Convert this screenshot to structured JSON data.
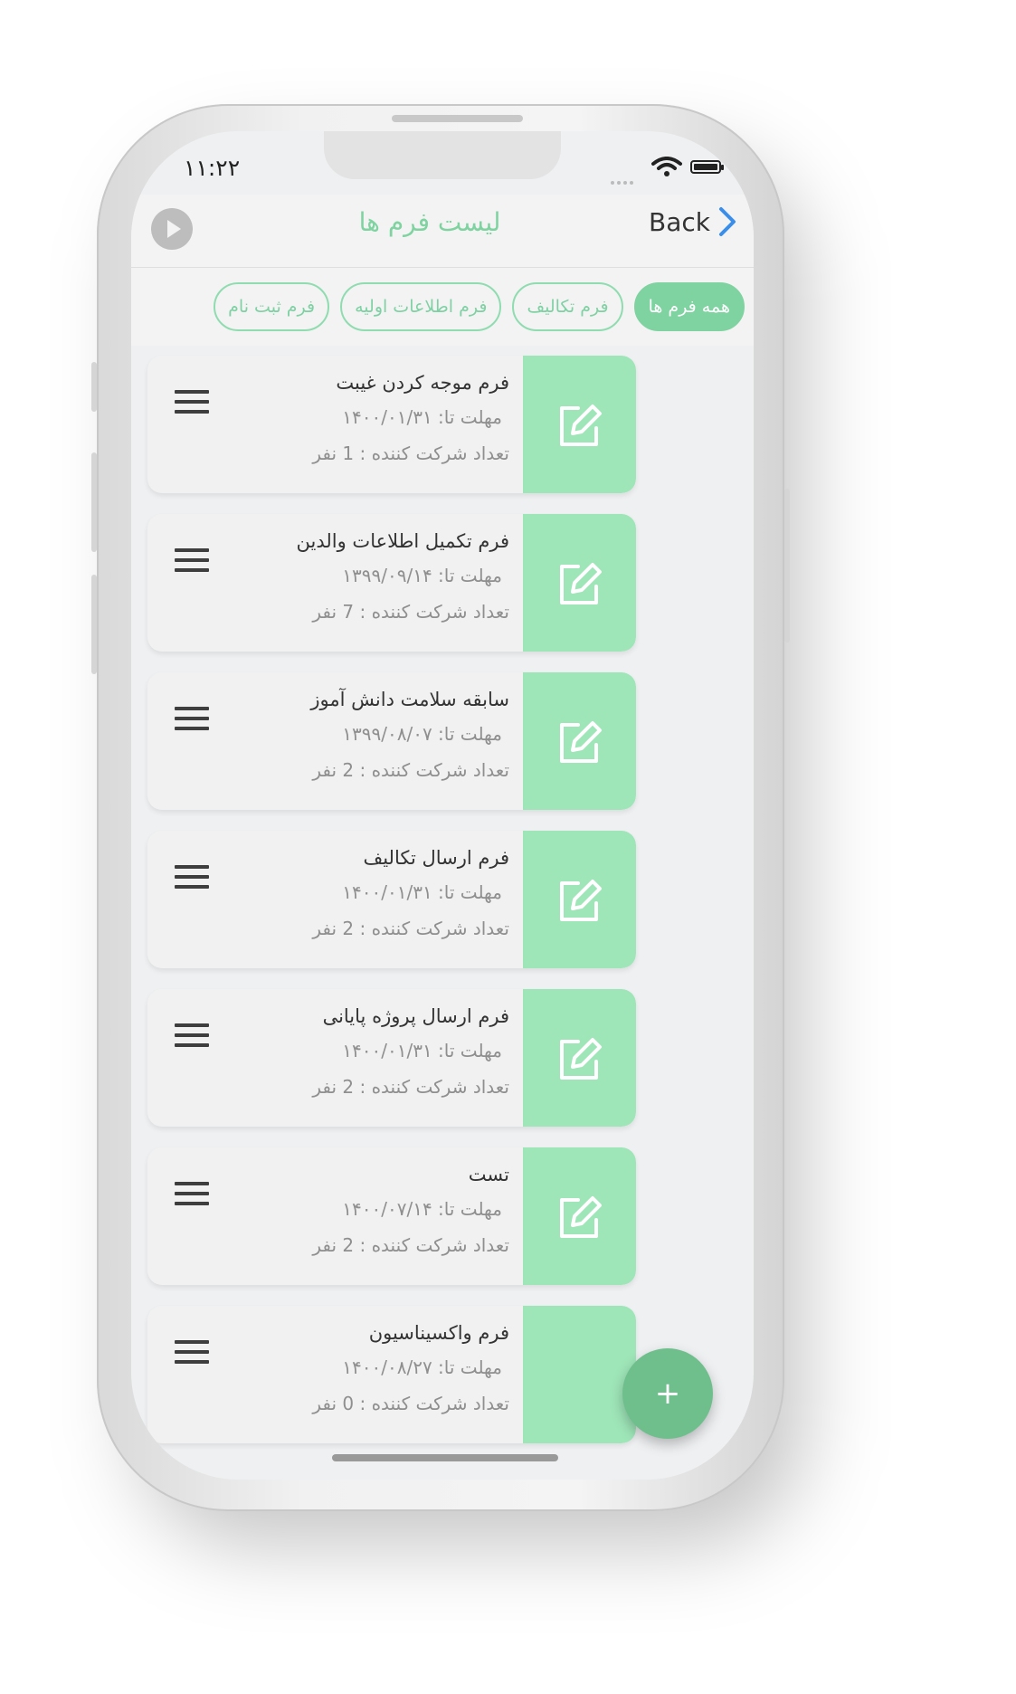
{
  "status": {
    "time": "۱۱:۲۲"
  },
  "header": {
    "title": "لیست فرم ها",
    "back_label": "Back"
  },
  "filters": [
    {
      "label": "همه فرم ها",
      "active": true
    },
    {
      "label": "فرم تکالیف",
      "active": false
    },
    {
      "label": "فرم اطلاعات اولیه",
      "active": false
    },
    {
      "label": "فرم ثبت نام",
      "active": false
    }
  ],
  "forms": [
    {
      "name": "فرم موجه کردن غیبت",
      "deadline": "مهلت تا: ۱۴۰۰/۰۱/۳۱",
      "participants": "تعداد شرکت کننده : 1 نفر"
    },
    {
      "name": "فرم تکمیل اطلاعات والدین",
      "deadline": "مهلت تا: ۱۳۹۹/۰۹/۱۴",
      "participants": "تعداد شرکت کننده : 7 نفر"
    },
    {
      "name": "سابقه سلامت دانش آموز",
      "deadline": "مهلت تا: ۱۳۹۹/۰۸/۰۷",
      "participants": "تعداد شرکت کننده : 2 نفر"
    },
    {
      "name": "فرم ارسال تکالیف",
      "deadline": "مهلت تا: ۱۴۰۰/۰۱/۳۱",
      "participants": "تعداد شرکت کننده : 2 نفر"
    },
    {
      "name": "فرم ارسال پروژه پایانی",
      "deadline": "مهلت تا: ۱۴۰۰/۰۱/۳۱",
      "participants": "تعداد شرکت کننده : 2 نفر"
    },
    {
      "name": "تست",
      "deadline": "مهلت تا: ۱۴۰۰/۰۷/۱۴",
      "participants": "تعداد شرکت کننده : 2 نفر"
    },
    {
      "name": "فرم واکسیناسیون",
      "deadline": "مهلت تا: ۱۴۰۰/۰۸/۲۷",
      "participants": "تعداد شرکت کننده : 0 نفر"
    }
  ],
  "fab_label": "+",
  "icons": {
    "play": "play-icon",
    "back": "chevron-right-icon",
    "menu": "hamburger-icon",
    "edit": "edit-icon",
    "wifi": "wifi-icon",
    "battery": "battery-icon"
  },
  "colors": {
    "accent": "#7ed3a0",
    "edit_bg": "#9ee5b8",
    "fab": "#6fbf8d"
  }
}
